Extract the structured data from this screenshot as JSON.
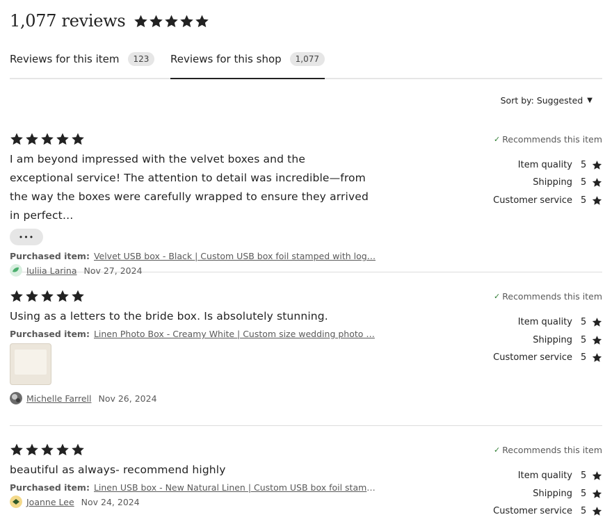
{
  "header": {
    "total": "1,077 reviews",
    "rating": 5
  },
  "tabs": [
    {
      "label": "Reviews for this item",
      "count": "123",
      "active": false
    },
    {
      "label": "Reviews for this shop",
      "count": "1,077",
      "active": true
    }
  ],
  "sort": {
    "label": "Sort by: Suggested"
  },
  "reviews": [
    {
      "stars": 5,
      "text": "I am beyond impressed with the velvet boxes and the exceptional service! The attention to detail was incredible—from the way the boxes were carefully wrapped to ensure they arrived in perfect…",
      "more_label": "•••",
      "purchased_label": "Purchased item:",
      "purchased_item": "Velvet USB box - Black | Custom USB box foil stamped with log…",
      "author": "Iuliia Larina",
      "date": "Nov 27, 2024",
      "recommends": "Recommends this item",
      "ratings": [
        {
          "label": "Item quality",
          "value": "5"
        },
        {
          "label": "Shipping",
          "value": "5"
        },
        {
          "label": "Customer service",
          "value": "5"
        }
      ]
    },
    {
      "stars": 5,
      "text": "Using as a letters to the bride box. Is absolutely stunning.",
      "purchased_label": "Purchased item:",
      "purchased_item": "Linen Photo Box - Creamy White | Custom size wedding photo …",
      "author": "Michelle Farrell",
      "date": "Nov 26, 2024",
      "recommends": "Recommends this item",
      "ratings": [
        {
          "label": "Item quality",
          "value": "5"
        },
        {
          "label": "Shipping",
          "value": "5"
        },
        {
          "label": "Customer service",
          "value": "5"
        }
      ]
    },
    {
      "stars": 5,
      "text": "beautiful as always- recommend highly",
      "purchased_label": "Purchased item:",
      "purchased_item": "Linen USB box - New Natural Linen | Custom USB box foil stamp…",
      "author": "Joanne Lee",
      "date": "Nov 24, 2024",
      "recommends": "Recommends this item",
      "ratings": [
        {
          "label": "Item quality",
          "value": "5"
        },
        {
          "label": "Shipping",
          "value": "5"
        },
        {
          "label": "Customer service",
          "value": "5"
        }
      ]
    }
  ],
  "colors": {
    "text": "#222222",
    "muted": "#595959",
    "badge": "#e6e6e6",
    "check": "#2e7d32",
    "divider": "#dcdcdc"
  }
}
